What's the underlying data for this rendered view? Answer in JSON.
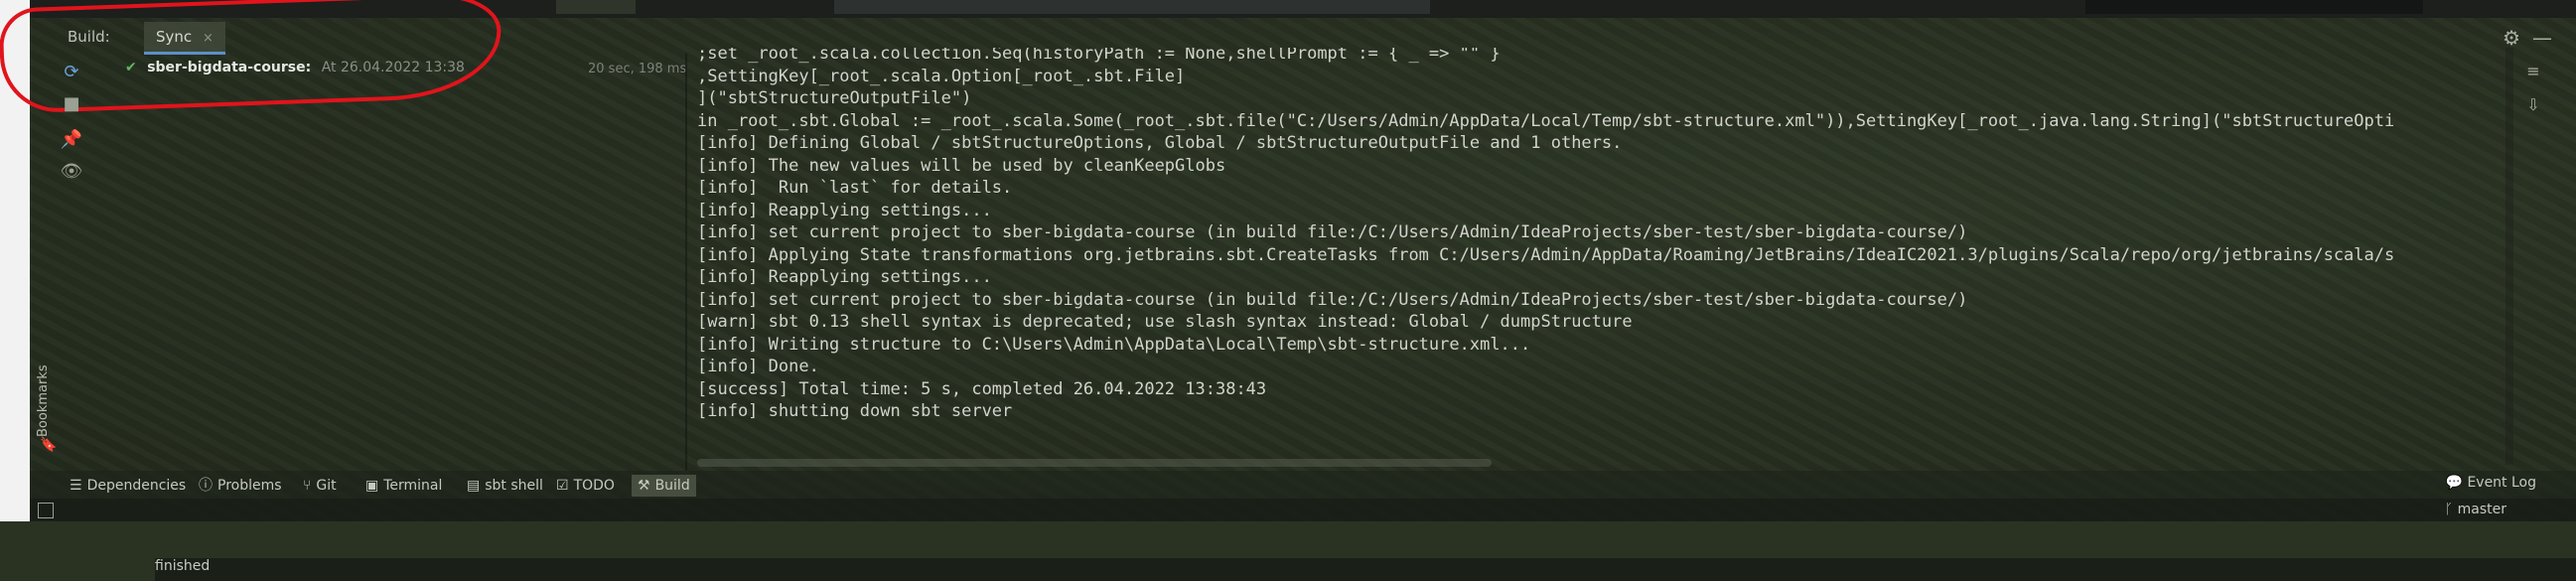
{
  "header": {
    "build_label": "Build:",
    "tab_sync": "Sync",
    "tab_close": "×"
  },
  "sync_tree": {
    "project": "sber-bigdata-course:",
    "status": "finished",
    "date": "At 26.04.2022 13:38",
    "duration": "20 sec, 198 ms"
  },
  "console_lines": [
    ";set _root_.scala.collection.Seq(historyPath := None,shellPrompt := { _ => \"\" }",
    ",SettingKey[_root_.scala.Option[_root_.sbt.File]",
    "](\"sbtStructureOutputFile\")",
    "in _root_.sbt.Global := _root_.scala.Some(_root_.sbt.file(\"C:/Users/Admin/AppData/Local/Temp/sbt-structure.xml\")),SettingKey[_root_.java.lang.String](\"sbtStructureOpti",
    "[info] Defining Global / sbtStructureOptions, Global / sbtStructureOutputFile and 1 others.",
    "[info] The new values will be used by cleanKeepGlobs",
    "[info]  Run `last` for details.",
    "[info] Reapplying settings...",
    "[info] set current project to sber-bigdata-course (in build file:/C:/Users/Admin/IdeaProjects/sber-test/sber-bigdata-course/)",
    "[info] Applying State transformations org.jetbrains.sbt.CreateTasks from C:/Users/Admin/AppData/Roaming/JetBrains/IdeaIC2021.3/plugins/Scala/repo/org/jetbrains/scala/s",
    "[info] Reapplying settings...",
    "[info] set current project to sber-bigdata-course (in build file:/C:/Users/Admin/IdeaProjects/sber-test/sber-bigdata-course/)",
    "[warn] sbt 0.13 shell syntax is deprecated; use slash syntax instead: Global / dumpStructure",
    "[info] Writing structure to C:\\Users\\Admin\\AppData\\Local\\Temp\\sbt-structure.xml...",
    "[info] Done.",
    "[success] Total time: 5 s, completed 26.04.2022 13:38:43",
    "[info] shutting down sbt server"
  ],
  "bottom_tabs": [
    {
      "label": "Dependencies",
      "icon": "layers-icon"
    },
    {
      "label": "Problems",
      "icon": "info-icon"
    },
    {
      "label": "Git",
      "icon": "branch-icon"
    },
    {
      "label": "Terminal",
      "icon": "terminal-icon"
    },
    {
      "label": "sbt shell",
      "icon": "shell-icon"
    },
    {
      "label": "TODO",
      "icon": "todo-icon"
    },
    {
      "label": "Build",
      "icon": "hammer-icon"
    }
  ],
  "sidebar": {
    "bookmarks": "Bookmarks"
  },
  "status_bar": {
    "event_log": "Event Log",
    "branch": "master"
  },
  "colors": {
    "accent": "#5d8ec9",
    "success": "#5fb85f",
    "annotation": "#e0141c"
  }
}
